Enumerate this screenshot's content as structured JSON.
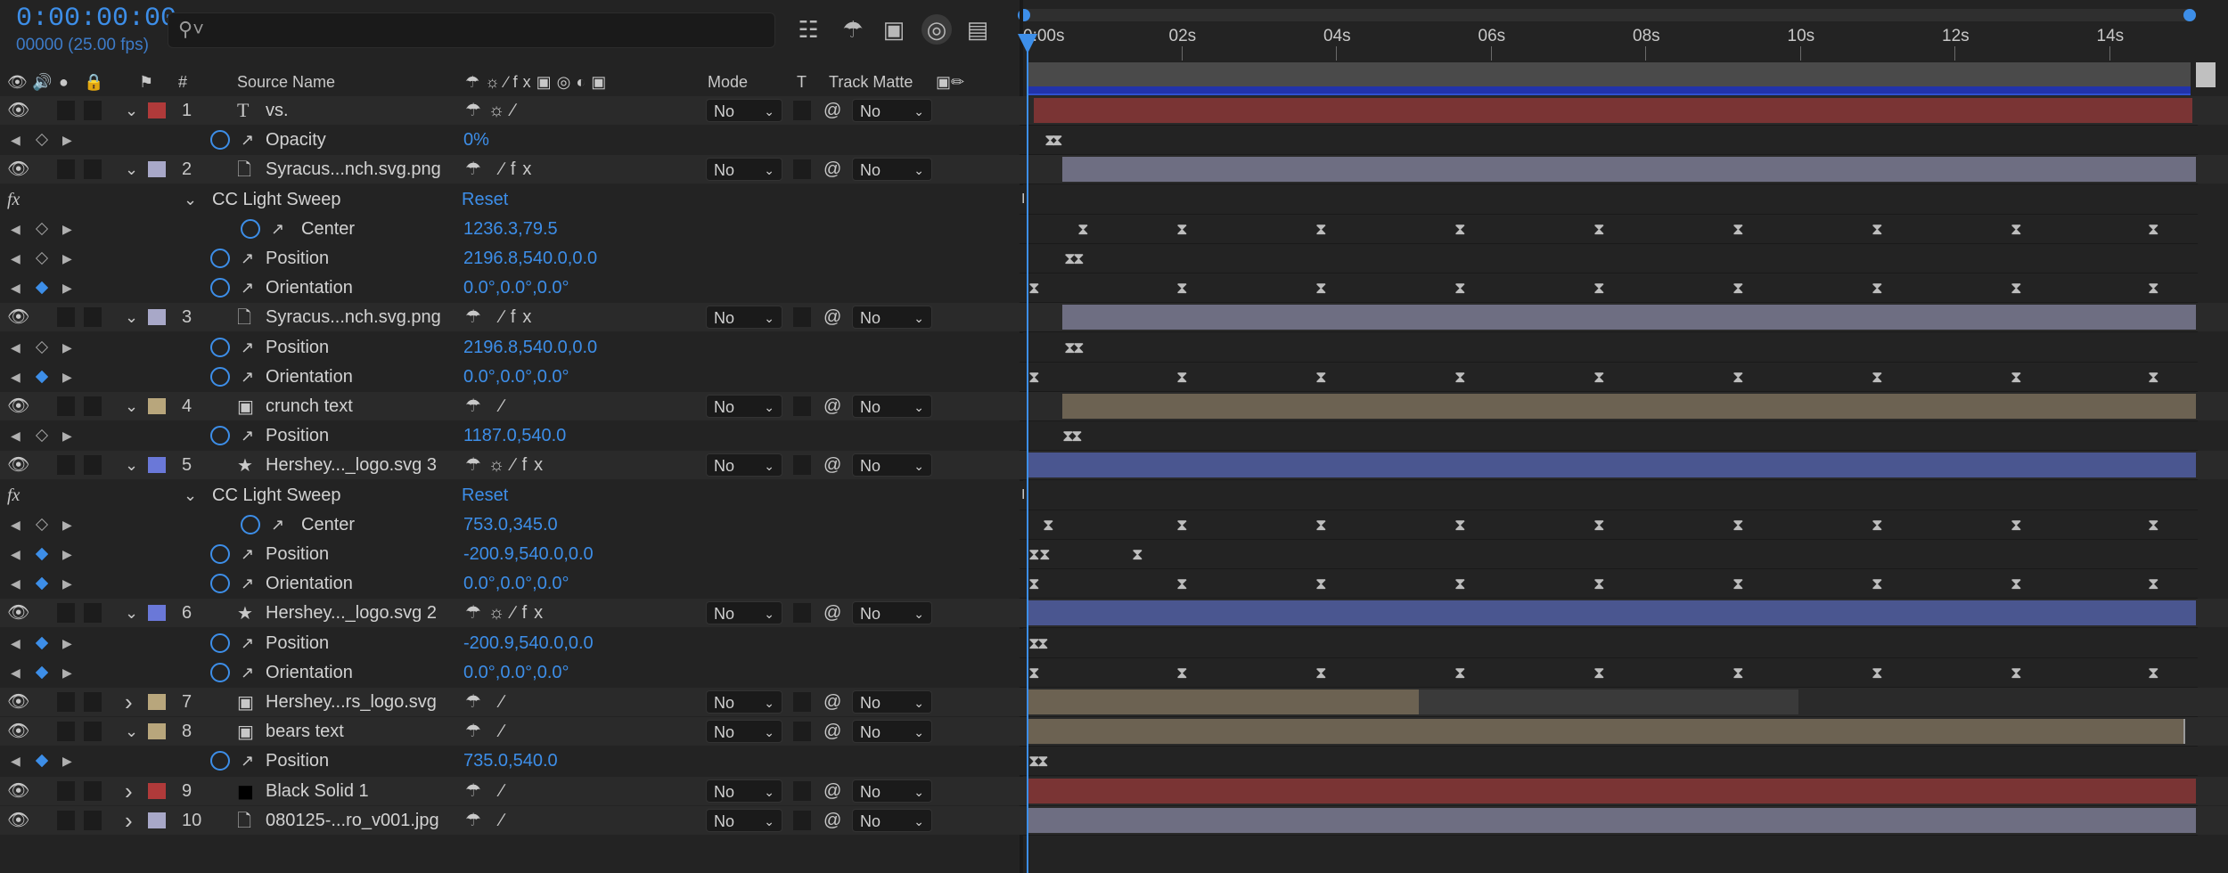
{
  "header": {
    "timecode": "0:00:00:00",
    "frame_info": "00000 (25.00 fps)",
    "search_placeholder": "",
    "search_icon": "search-icon"
  },
  "columns": {
    "number": "#",
    "source_name": "Source Name",
    "mode": "Mode",
    "t": "T",
    "track_matte": "Track Matte"
  },
  "ruler": {
    "ticks": [
      "0:00s",
      "02s",
      "04s",
      "06s",
      "08s",
      "10s",
      "12s",
      "14s"
    ]
  },
  "rows": [
    {
      "kind": "layer",
      "num": "1",
      "name": "vs.",
      "type_icon": "T",
      "label_color": "#b03a3a",
      "mode": "No",
      "matte": "No",
      "expanded": true
    },
    {
      "kind": "prop",
      "name": "Opacity",
      "value": "0%"
    },
    {
      "kind": "layer",
      "num": "2",
      "name": "Syracus...nch.svg.png",
      "type_icon": "file",
      "label_color": "#a8a8c8",
      "mode": "No",
      "matte": "No",
      "expanded": true
    },
    {
      "kind": "fx",
      "name": "CC Light Sweep",
      "value": "Reset"
    },
    {
      "kind": "prop",
      "name": "Center",
      "value": "1236.3,79.5"
    },
    {
      "kind": "prop",
      "name": "Position",
      "value": "2196.8,540.0,0.0"
    },
    {
      "kind": "prop",
      "name": "Orientation",
      "value": "0.0°,0.0°,0.0°"
    },
    {
      "kind": "layer",
      "num": "3",
      "name": "Syracus...nch.svg.png",
      "type_icon": "file",
      "label_color": "#a8a8c8",
      "mode": "No",
      "matte": "No",
      "expanded": true
    },
    {
      "kind": "prop",
      "name": "Position",
      "value": "2196.8,540.0,0.0"
    },
    {
      "kind": "prop",
      "name": "Orientation",
      "value": "0.0°,0.0°,0.0°"
    },
    {
      "kind": "layer",
      "num": "4",
      "name": "crunch text",
      "type_icon": "comp",
      "label_color": "#b8a67c",
      "mode": "No",
      "matte": "No",
      "expanded": true
    },
    {
      "kind": "prop",
      "name": "Position",
      "value": "1187.0,540.0"
    },
    {
      "kind": "layer",
      "num": "5",
      "name": "Hershey..._logo.svg 3",
      "type_icon": "star",
      "label_color": "#6a78d8",
      "mode": "No",
      "matte": "No",
      "expanded": true
    },
    {
      "kind": "fx",
      "name": "CC Light Sweep",
      "value": "Reset"
    },
    {
      "kind": "prop",
      "name": "Center",
      "value": "753.0,345.0"
    },
    {
      "kind": "prop",
      "name": "Position",
      "value": "-200.9,540.0,0.0"
    },
    {
      "kind": "prop",
      "name": "Orientation",
      "value": "0.0°,0.0°,0.0°"
    },
    {
      "kind": "layer",
      "num": "6",
      "name": "Hershey..._logo.svg 2",
      "type_icon": "star",
      "label_color": "#6a78d8",
      "mode": "No",
      "matte": "No",
      "expanded": true
    },
    {
      "kind": "prop",
      "name": "Position",
      "value": "-200.9,540.0,0.0"
    },
    {
      "kind": "prop",
      "name": "Orientation",
      "value": "0.0°,0.0°,0.0°"
    },
    {
      "kind": "layer",
      "num": "7",
      "name": "Hershey...rs_logo.svg",
      "type_icon": "comp",
      "label_color": "#b8a67c",
      "mode": "No",
      "matte": "No",
      "expanded": false
    },
    {
      "kind": "layer",
      "num": "8",
      "name": "bears text",
      "type_icon": "comp",
      "label_color": "#b8a67c",
      "mode": "No",
      "matte": "No",
      "expanded": true
    },
    {
      "kind": "prop",
      "name": "Position",
      "value": "735.0,540.0"
    },
    {
      "kind": "layer",
      "num": "9",
      "name": "Black Solid 1",
      "type_icon": "solid",
      "label_color": "#b03a3a",
      "mode": "No",
      "matte": "No",
      "expanded": false
    },
    {
      "kind": "layer",
      "num": "10",
      "name": "080125-...ro_v001.jpg",
      "type_icon": "file",
      "label_color": "#a8a8c8",
      "mode": "No",
      "matte": "No",
      "expanded": false
    }
  ],
  "colors": {
    "accent": "#3d8ee8",
    "layer_red": "#7a3434",
    "layer_lavender": "#6e6e82",
    "layer_tan": "#6c6252",
    "layer_blue": "#4a5690"
  }
}
